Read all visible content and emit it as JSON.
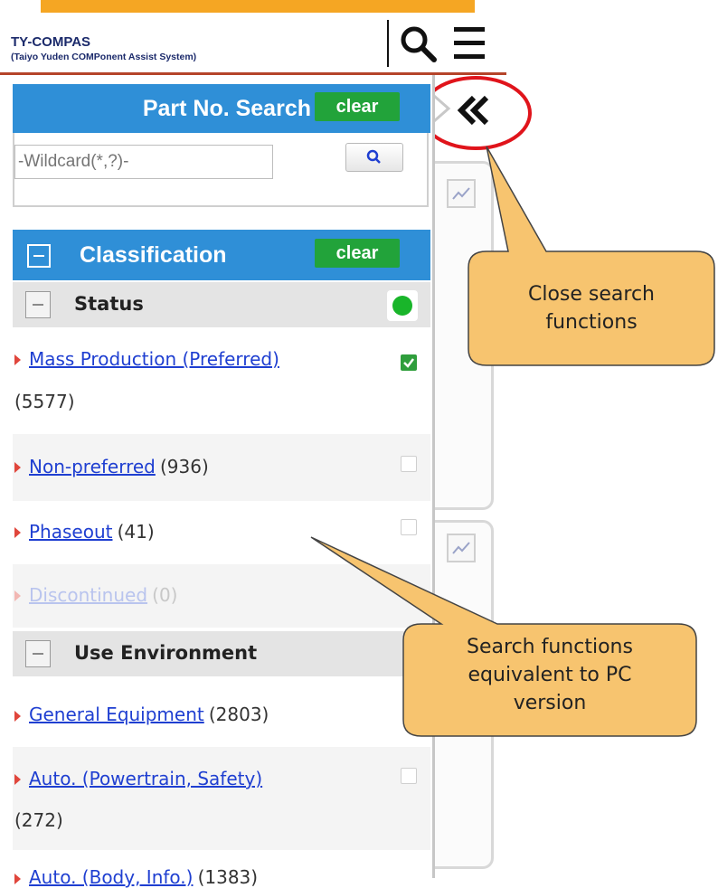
{
  "header": {
    "title": "TY-COMPAS",
    "subtitle": "(Taiyo Yuden COMPonent Assist System)"
  },
  "part_search": {
    "title": "Part No. Search",
    "clear_label": "clear",
    "input_placeholder": "-Wildcard(*,?)-"
  },
  "classification": {
    "title": "Classification",
    "clear_label": "clear"
  },
  "status": {
    "title": "Status",
    "items": [
      {
        "label": "Mass Production (Preferred)",
        "count": "(5577)",
        "checked": true
      },
      {
        "label": "Non-preferred",
        "count": "(936)",
        "checked": false
      },
      {
        "label": "Phaseout",
        "count": "(41)",
        "checked": false
      },
      {
        "label": "Discontinued",
        "count": "(0)",
        "checked": false,
        "disabled": true
      }
    ]
  },
  "use_environment": {
    "title": "Use Environment",
    "items": [
      {
        "label": "General Equipment",
        "count": "(2803)"
      },
      {
        "label": "Auto. (Powertrain, Safety)",
        "count": "(272)"
      },
      {
        "label": "Auto. (Body, Info.)",
        "count": "(1383)"
      }
    ]
  },
  "callouts": {
    "close": "Close search functions",
    "close_line1": "Close search",
    "close_line2": "functions",
    "equiv_line1": "Search functions",
    "equiv_line2": "equivalent to PC",
    "equiv_line3": "version"
  },
  "colors": {
    "accent_blue": "#2f8fd7",
    "clear_green": "#22a33a",
    "callout_orange": "#f7c46f",
    "highlight_red": "#e0141b",
    "link_blue": "#1f3fd1"
  },
  "icons": [
    "search-icon",
    "menu-icon",
    "collapse-panel-icon",
    "chart-icon",
    "status-dot-icon",
    "checkbox-icon",
    "arrow-bullet-icon"
  ]
}
